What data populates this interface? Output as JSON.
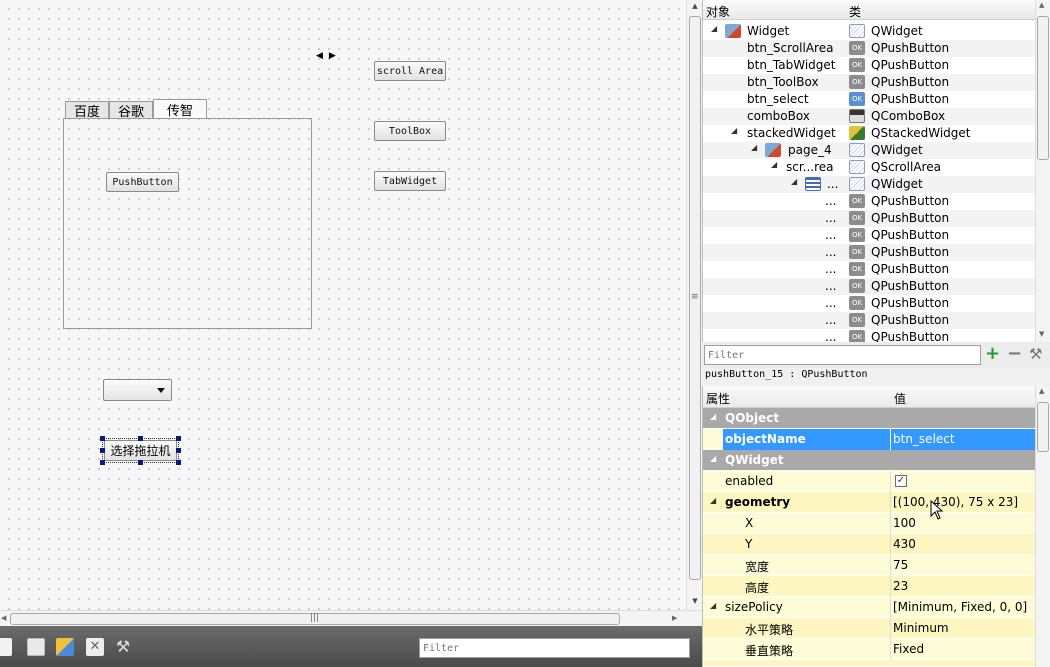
{
  "canvas": {
    "tabs": [
      "百度",
      "谷歌",
      "传智"
    ],
    "active_tab": 2,
    "tab_pushbutton": "PushButton",
    "btn_scroll_area": "scroll Area",
    "btn_toolbox": "ToolBox",
    "btn_tabwidget": "TabWidget",
    "btn_select": "选择拖拉机"
  },
  "bottom_filter_placeholder": "Filter",
  "object_inspector": {
    "col_object": "对象",
    "col_class": "类",
    "rows": [
      {
        "name": "Widget",
        "type": "QWidget"
      },
      {
        "name": "btn_ScrollArea",
        "type": "QPushButton"
      },
      {
        "name": "btn_TabWidget",
        "type": "QPushButton"
      },
      {
        "name": "btn_ToolBox",
        "type": "QPushButton"
      },
      {
        "name": "btn_select",
        "type": "QPushButton"
      },
      {
        "name": "comboBox",
        "type": "QComboBox"
      },
      {
        "name": "stackedWidget",
        "type": "QStackedWidget"
      },
      {
        "name": "page_4",
        "type": "QWidget"
      },
      {
        "name": "scr...rea",
        "type": "QScrollArea"
      },
      {
        "name": "...",
        "type": "QWidget"
      },
      {
        "name": "...",
        "type": "QPushButton"
      },
      {
        "name": "...",
        "type": "QPushButton"
      },
      {
        "name": "...",
        "type": "QPushButton"
      },
      {
        "name": "...",
        "type": "QPushButton"
      },
      {
        "name": "...",
        "type": "QPushButton"
      },
      {
        "name": "...",
        "type": "QPushButton"
      },
      {
        "name": "...",
        "type": "QPushButton"
      },
      {
        "name": "...",
        "type": "QPushButton"
      },
      {
        "name": "...",
        "type": "QPushButton"
      }
    ],
    "filter_placeholder": "Filter"
  },
  "selection_info": "pushButton_15 : QPushButton",
  "property_editor": {
    "col_property": "属性",
    "col_value": "值",
    "rows": [
      {
        "name": "QObject",
        "value": ""
      },
      {
        "name": "objectName",
        "value": "btn_select"
      },
      {
        "name": "QWidget",
        "value": ""
      },
      {
        "name": "enabled",
        "value": "✓"
      },
      {
        "name": "geometry",
        "value": "[(100, 430), 75 x 23]"
      },
      {
        "name": "X",
        "value": "100"
      },
      {
        "name": "Y",
        "value": "430"
      },
      {
        "name": "宽度",
        "value": "75"
      },
      {
        "name": "高度",
        "value": "23"
      },
      {
        "name": "sizePolicy",
        "value": "[Minimum, Fixed, 0, 0]"
      },
      {
        "name": "水平策略",
        "value": "Minimum"
      },
      {
        "name": "垂直策略",
        "value": "Fixed"
      }
    ]
  },
  "icon_colors": {
    "ok_icon": "#8c8c8c",
    "selection": "#3399ff",
    "group_row": "#a9a9a9",
    "add": "#2a9a2a"
  }
}
